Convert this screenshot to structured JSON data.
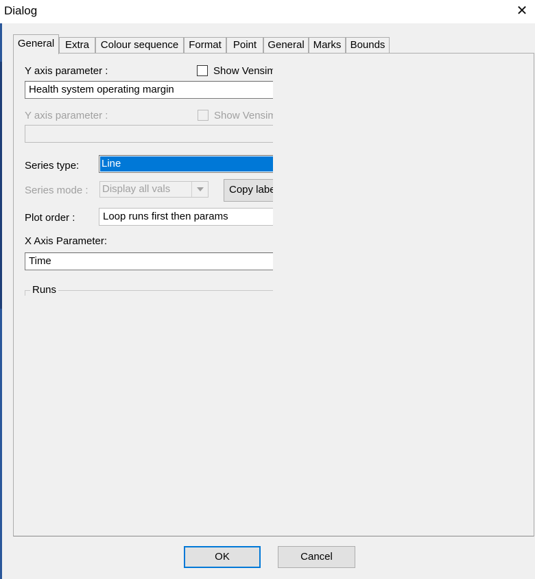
{
  "window": {
    "title": "Dialog",
    "close_glyph": "✕"
  },
  "tabs": [
    {
      "label": "General",
      "active": true
    },
    {
      "label": "Extra"
    },
    {
      "label": "Colour sequence"
    },
    {
      "label": "Format"
    },
    {
      "label": "Point"
    },
    {
      "label": "General"
    },
    {
      "label": "Marks"
    },
    {
      "label": "Bounds"
    }
  ],
  "general": {
    "y_axis_label": "Y axis parameter :",
    "show_vensim_label": "Show Vensim",
    "y_axis_value": "Health system operating margin",
    "y_axis2_label": "Y axis parameter :",
    "show_vensim2_label": "Show Vensim",
    "y_axis2_value": "",
    "series_type_label": "Series type:",
    "series_type_value": "Line",
    "series_mode_label": "Series mode :",
    "series_mode_value": "Display all vals",
    "copy_labels_label": "Copy labels",
    "plot_order_label": "Plot order :",
    "plot_order_value": "Loop runs first then params",
    "x_axis_label": "X Axis Parameter:",
    "x_axis_value": "Time",
    "runs_label": "Runs"
  },
  "buttons": {
    "ok": "OK",
    "cancel": "Cancel"
  },
  "colors": {
    "selection": "#0078d7",
    "dialog_bg": "#f0f0f0"
  }
}
